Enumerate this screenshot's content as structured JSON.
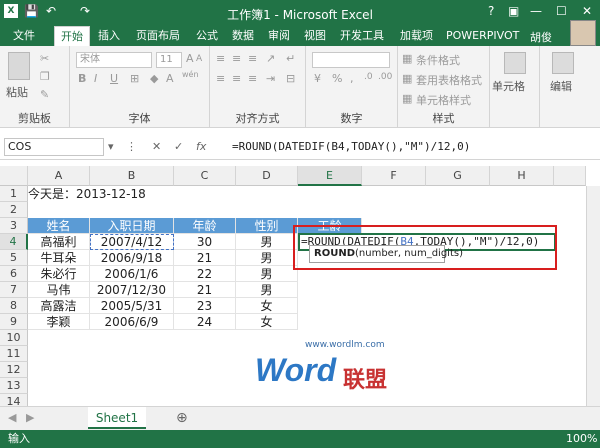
{
  "window": {
    "title": "工作簿1 - Microsoft Excel",
    "quick_access": {
      "save": "💾",
      "undo": "↶",
      "redo": "↷"
    },
    "controls": {
      "help": "?",
      "ribbon_options": "▣",
      "minimize": "—",
      "maximize": "☐",
      "close": "✕"
    }
  },
  "tabs": {
    "file": "文件",
    "items": [
      "开始",
      "插入",
      "页面布局",
      "公式",
      "数据",
      "审阅",
      "视图",
      "开发工具",
      "加载项",
      "POWERPIVOT"
    ],
    "user": "胡俊"
  },
  "ribbon": {
    "clipboard": {
      "label": "剪贴板",
      "paste": "粘贴"
    },
    "font": {
      "label": "字体",
      "font_name": "宋体",
      "font_size": "11",
      "bold": "B",
      "italic": "I",
      "underline": "U",
      "grow": "A",
      "shrink": "A",
      "wen": "wén"
    },
    "alignment": {
      "label": "对齐方式"
    },
    "number": {
      "label": "数字",
      "percent": "%"
    },
    "styles": {
      "label": "样式",
      "cond_format": "条件格式",
      "table_format": "套用表格格式",
      "cell_styles": "单元格样式"
    },
    "cells": {
      "label": "单元格"
    },
    "edit": {
      "label": "编辑"
    }
  },
  "formula_bar": {
    "name_box": "COS",
    "cancel": "✕",
    "enter": "✓",
    "fx": "fx",
    "formula": "=ROUND(DATEDIF(B4,TODAY(),\"M\")/12,0)"
  },
  "grid": {
    "columns": [
      "A",
      "B",
      "C",
      "D",
      "E",
      "F",
      "G",
      "H"
    ],
    "rows": [
      "1",
      "2",
      "3",
      "4",
      "5",
      "6",
      "7",
      "8",
      "9",
      "10",
      "11",
      "12",
      "13",
      "14"
    ],
    "a1": "今天是：2013-12-18",
    "headers": [
      "姓名",
      "入职日期",
      "年龄",
      "性别",
      "工龄"
    ],
    "data": [
      [
        "高福利",
        "2007/4/12",
        "30",
        "男"
      ],
      [
        "牛耳朵",
        "2006/9/18",
        "21",
        "男"
      ],
      [
        "朱必行",
        "2006/1/6",
        "22",
        "男"
      ],
      [
        "马伟",
        "2007/12/30",
        "21",
        "男"
      ],
      [
        "高露洁",
        "2005/5/31",
        "23",
        "女"
      ],
      [
        "李颖",
        "2006/6/9",
        "24",
        "女"
      ]
    ],
    "active_formula_parts": {
      "before": "=ROUND(DATEDIF(",
      "ref": "B4",
      "after": ",TODAY(),\"M\")/12,0)"
    },
    "tooltip": {
      "fn": "ROUND",
      "args": "(number, num_digits)"
    }
  },
  "watermark": {
    "url": "www.wordlm.com",
    "word": "Word",
    "cn": "联盟"
  },
  "sheets": {
    "active": "Sheet1",
    "add": "⊕"
  },
  "status": {
    "mode": "输入",
    "zoom": "100%"
  }
}
